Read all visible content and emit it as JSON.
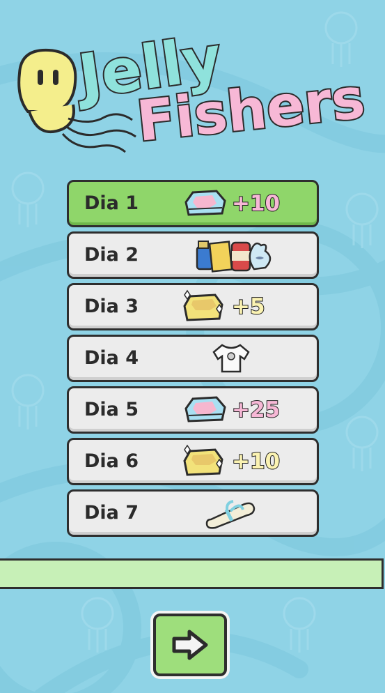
{
  "game": {
    "title_line1": "Jelly",
    "title_line2": "Fishers"
  },
  "rewards": [
    {
      "day": "Dia 1",
      "reward_icon": "gem-icon",
      "amount": "+10",
      "amount_color": "#f7b8d6",
      "claimed": true
    },
    {
      "day": "Dia 2",
      "reward_icon": "food-bundle-icon",
      "amount": "",
      "claimed": false
    },
    {
      "day": "Dia 3",
      "reward_icon": "gold-coin-icon",
      "amount": "+5",
      "amount_color": "#fbf3b2",
      "claimed": false
    },
    {
      "day": "Dia 4",
      "reward_icon": "tshirt-icon",
      "amount": "",
      "claimed": false
    },
    {
      "day": "Dia 5",
      "reward_icon": "gem-icon",
      "amount": "+25",
      "amount_color": "#f7b8d6",
      "claimed": false
    },
    {
      "day": "Dia 6",
      "reward_icon": "gold-coin-icon",
      "amount": "+10",
      "amount_color": "#fbf3b2",
      "claimed": false
    },
    {
      "day": "Dia 7",
      "reward_icon": "scroll-icon",
      "amount": "",
      "claimed": false
    }
  ],
  "colors": {
    "background": "#8fd3e6",
    "active_row": "#8fd66a",
    "row": "#ececec",
    "progress_bar": "#c7f0b7",
    "button": "#9ede7c"
  }
}
